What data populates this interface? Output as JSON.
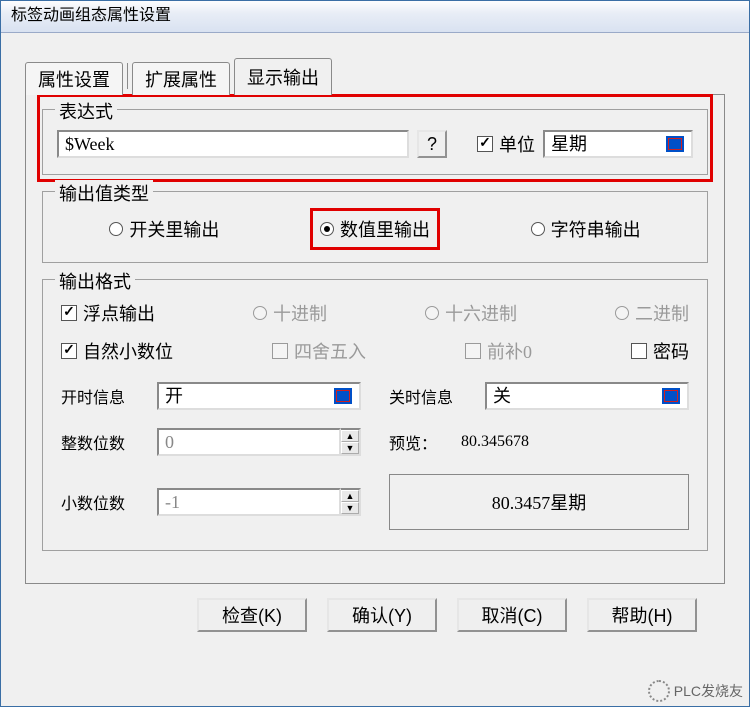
{
  "title": "标签动画组态属性设置",
  "tabs": {
    "t1": "属性设置",
    "t2": "扩展属性",
    "t3": "显示输出"
  },
  "expr": {
    "legend": "表达式",
    "value": "$Week",
    "help": "?",
    "unitLabel": "单位",
    "unitChecked": true,
    "unitValue": "星期"
  },
  "outtype": {
    "legend": "输出值类型",
    "opt1": "开关里输出",
    "opt2": "数值里输出",
    "opt3": "字符串输出",
    "selected": 2
  },
  "fmt": {
    "legend": "输出格式",
    "floatOut": "浮点输出",
    "floatOutChecked": true,
    "dec": "十进制",
    "hex": "十六进制",
    "bin": "二进制",
    "naturalDec": "自然小数位",
    "naturalDecChecked": true,
    "round": "四舍五入",
    "padZero": "前补0",
    "password": "密码",
    "passwordChecked": false,
    "onInfoLabel": "开时信息",
    "onInfoValue": "开",
    "offInfoLabel": "关时信息",
    "offInfoValue": "关",
    "intDigitsLabel": "整数位数",
    "intDigitsValue": "0",
    "decDigitsLabel": "小数位数",
    "decDigitsValue": "-1",
    "previewLabel": "预览：",
    "previewShort": "80.345678",
    "previewBox": "80.3457星期"
  },
  "buttons": {
    "check": "检查(K)",
    "ok": "确认(Y)",
    "cancel": "取消(C)",
    "help": "帮助(H)"
  },
  "watermark": "PLC发烧友"
}
